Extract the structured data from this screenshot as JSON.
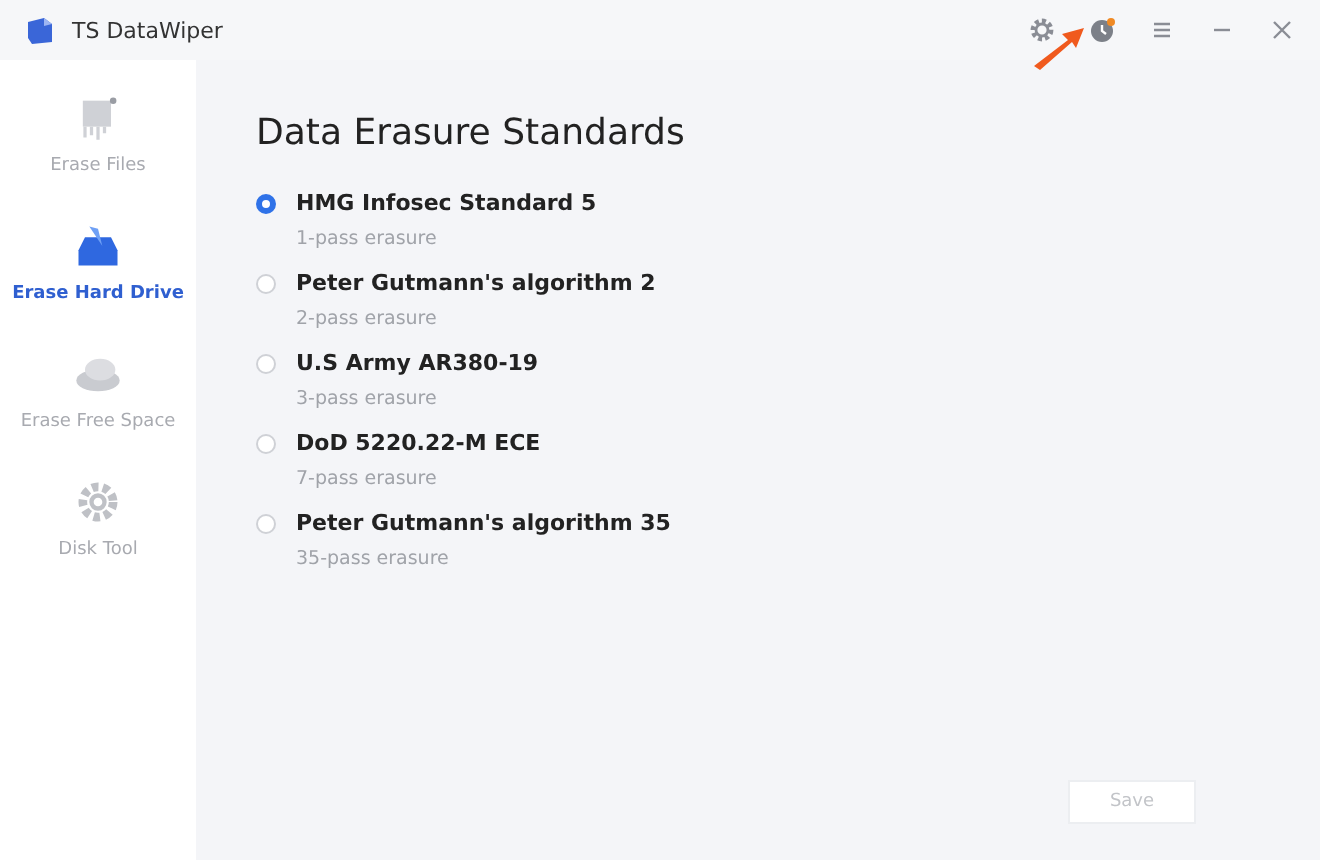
{
  "window": {
    "title": "TS DataWiper"
  },
  "sidebar": {
    "items": [
      {
        "label": "Erase Files",
        "kind": "files",
        "selected": false
      },
      {
        "label": "Erase Hard Drive",
        "kind": "drive",
        "selected": true
      },
      {
        "label": "Erase Free Space",
        "kind": "space",
        "selected": false
      },
      {
        "label": "Disk Tool",
        "kind": "tool",
        "selected": false
      }
    ]
  },
  "heading": "Data Erasure Standards",
  "standards": [
    {
      "name": "HMG Infosec Standard 5",
      "detail": "1-pass erasure",
      "selected": true
    },
    {
      "name": "Peter Gutmann's algorithm 2",
      "detail": "2-pass erasure",
      "selected": false
    },
    {
      "name": "U.S Army AR380-19",
      "detail": "3-pass erasure",
      "selected": false
    },
    {
      "name": "DoD 5220.22-M ECE",
      "detail": "7-pass erasure",
      "selected": false
    },
    {
      "name": "Peter Gutmann's algorithm 35",
      "detail": "35-pass erasure",
      "selected": false
    }
  ],
  "save_button": {
    "label": "Save",
    "disabled": true
  }
}
